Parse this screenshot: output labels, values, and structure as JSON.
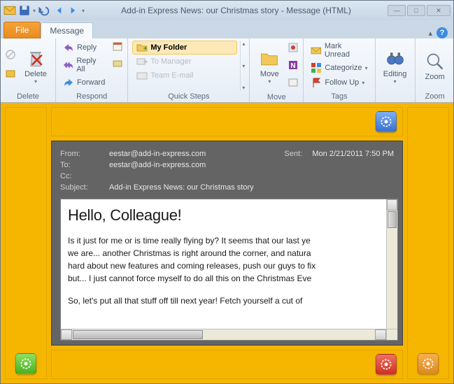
{
  "window": {
    "title": "Add-in Express News: our Christmas story  -  Message (HTML)"
  },
  "tabs": {
    "file": "File",
    "message": "Message"
  },
  "ribbon": {
    "delete": {
      "label": "Delete",
      "group": "Delete"
    },
    "respond": {
      "reply": "Reply",
      "reply_all": "Reply All",
      "forward": "Forward",
      "group": "Respond"
    },
    "quicksteps": {
      "myfolder": "My Folder",
      "tomanager": "To Manager",
      "teamemail": "Team E-mail",
      "group": "Quick Steps"
    },
    "move": {
      "label": "Move",
      "group": "Move"
    },
    "tags": {
      "unread": "Mark Unread",
      "categorize": "Categorize",
      "followup": "Follow Up",
      "group": "Tags"
    },
    "editing": {
      "label": "Editing"
    },
    "zoom": {
      "label": "Zoom",
      "group": "Zoom"
    }
  },
  "mail": {
    "from_label": "From:",
    "from": "eestar@add-in-express.com",
    "sent_label": "Sent:",
    "sent": "Mon 2/21/2011 7:50 PM",
    "to_label": "To:",
    "to": "eestar@add-in-express.com",
    "cc_label": "Cc:",
    "cc": "",
    "subject_label": "Subject:",
    "subject": "Add-in Express News: our Christmas story",
    "body_heading": "Hello, Colleague!",
    "body_p1": "Is it just for me or is time really flying by? It seems that our last ye",
    "body_p2": "we are... another Christmas is right around the corner, and natura",
    "body_p3": "hard about new features and coming releases, push our guys to fix",
    "body_p4": "but... I just cannot force myself to do all this on the Christmas Eve",
    "body_p5": "So, let's put all that stuff off till next year! Fetch yourself a cut of"
  },
  "colors": {
    "gear_blue": "#4e8ff0",
    "gear_green": "#5cc040",
    "gear_red": "#e84c3c",
    "gear_orange": "#f08c2c"
  }
}
